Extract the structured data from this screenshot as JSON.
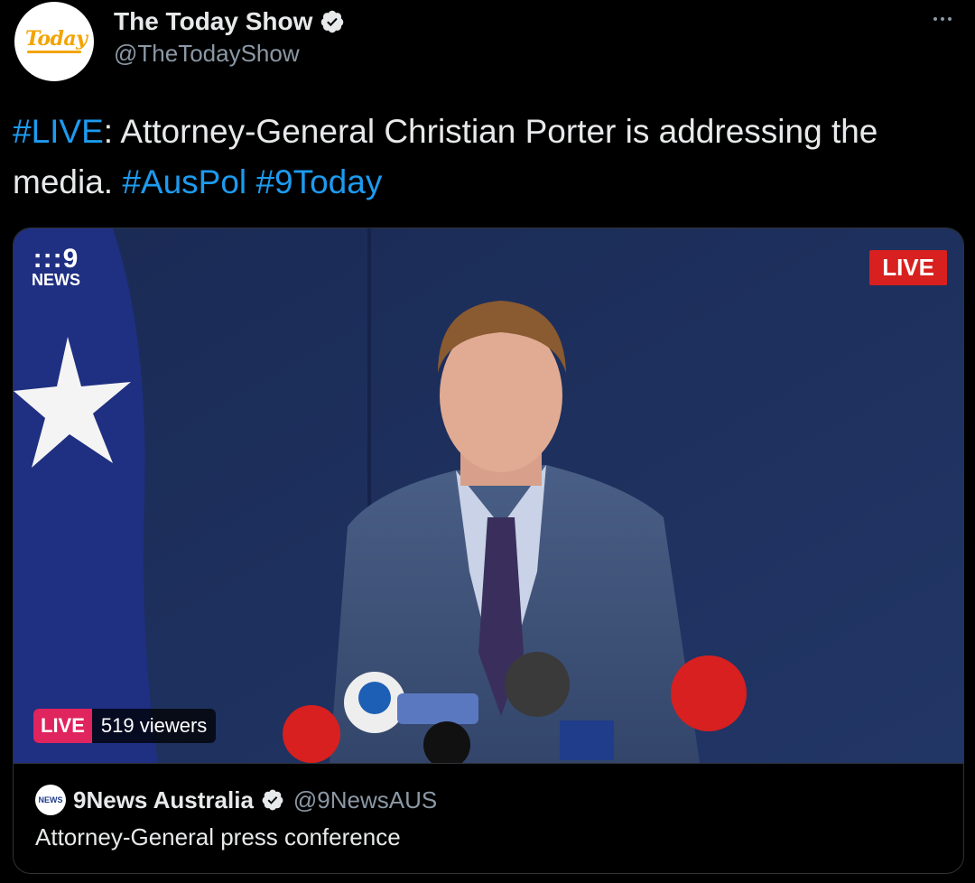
{
  "author": {
    "display_name": "The Today Show",
    "handle": "@TheTodayShow",
    "avatar_text": "Today",
    "verified": true
  },
  "tweet": {
    "tag_live": "#LIVE",
    "text_main": ": Attorney-General Christian Porter is addressing the media. ",
    "tag_auspol": "#AusPol",
    "tag_9today": "#9Today"
  },
  "video": {
    "logo_mark": ":::9",
    "logo_text": "NEWS",
    "live_badge": "LIVE",
    "live_tag": "LIVE",
    "viewers": "519 viewers"
  },
  "card": {
    "author_name": "9News Australia",
    "handle": "@9NewsAUS",
    "title": "Attorney-General press conference",
    "avatar_text": "NEWS"
  },
  "colors": {
    "background": "#000000",
    "link": "#1d9bf0",
    "secondary_text": "#8b98a5",
    "live_red": "#d7201f",
    "live_pink": "#e0245e"
  },
  "icons": [
    "verified-badge-icon",
    "more-dots-icon"
  ]
}
